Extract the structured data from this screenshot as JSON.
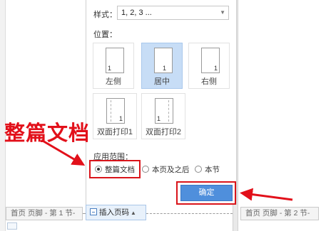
{
  "dialog": {
    "style_label": "样式：",
    "style_value": "1, 2, 3 ...",
    "position_label": "位置：",
    "positions": [
      {
        "label": "左侧",
        "page_number": "1",
        "selected": false
      },
      {
        "label": "居中",
        "page_number": "1",
        "selected": true
      },
      {
        "label": "右侧",
        "page_number": "1",
        "selected": false
      },
      {
        "label": "双面打印1",
        "page_number": "1",
        "selected": false
      },
      {
        "label": "双面打印2",
        "page_number": "1",
        "selected": false
      }
    ],
    "apply_label": "应用范围：",
    "apply_options": [
      {
        "label": "整篇文档",
        "checked": true
      },
      {
        "label": "本页及之后",
        "checked": false
      },
      {
        "label": "本节",
        "checked": false
      }
    ],
    "ok_label": "确定"
  },
  "footer": {
    "left_tag": "首页 页脚 - 第 1 节-",
    "right_tag": "首页 页脚 - 第 2 节-",
    "insert_button": "插入页码"
  },
  "annotation": {
    "text": "整篇文档",
    "color": "#e2101a"
  },
  "colors": {
    "accent": "#4f8fdc",
    "selected_bg": "#c7ddf6",
    "highlight": "#d9141a"
  }
}
